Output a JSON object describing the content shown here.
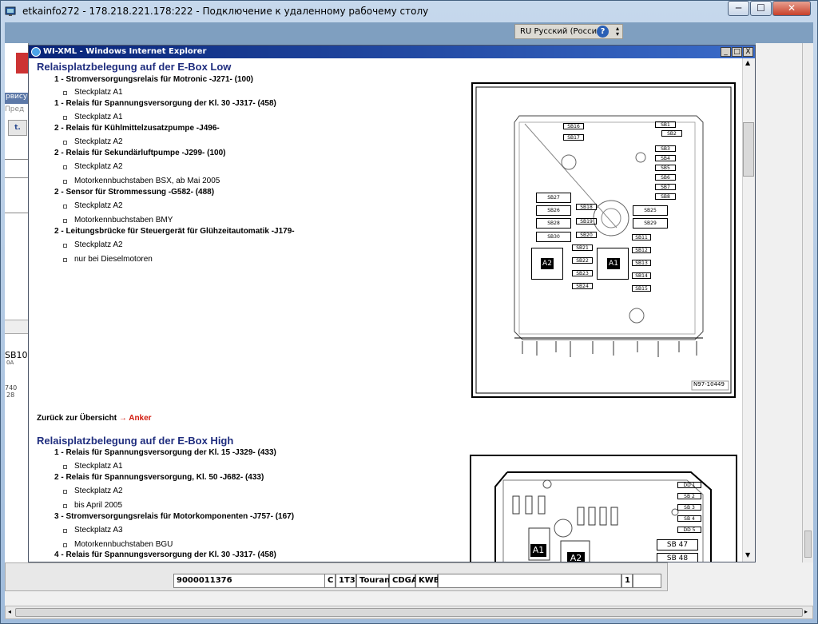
{
  "rdp": {
    "title": "etkainfo272 - 178.218.221.178:222 - Подключение к удаленному рабочему столу",
    "lang": "RU Русский (Россия)",
    "help": "?",
    "minimize": "─",
    "maximize": "☐",
    "close": "✕"
  },
  "bg": {
    "label1": "рвису",
    "label2": "Пред",
    "label3": "SB10",
    "label4": "0A",
    "label5": "740",
    "label6": "28"
  },
  "ie": {
    "title": "WI-XML - Windows Internet Explorer",
    "min": "_",
    "max": "□",
    "close": "X"
  },
  "section1": {
    "heading": "Relaisplatzbelegung auf der E-Box Low",
    "items": [
      {
        "text": "1 - Stromversorgungsrelais für Motronic -J271- (100)",
        "subs": [
          "Steckplatz A1"
        ]
      },
      {
        "text": "1 - Relais für Spannungsversorgung der Kl. 30 -J317- (458)",
        "subs": [
          "Steckplatz A1"
        ]
      },
      {
        "text": "2 - Relais für Kühlmittelzusatzpumpe -J496-",
        "subs": [
          "Steckplatz A2"
        ]
      },
      {
        "text": "2 - Relais für Sekundärluftpumpe -J299- (100)",
        "subs": [
          "Steckplatz A2",
          "Motorkennbuchstaben BSX, ab Mai 2005"
        ]
      },
      {
        "text": "2 - Sensor für Strommessung -G582- (488)",
        "subs": [
          "Steckplatz A2",
          "Motorkennbuchstaben BMY"
        ]
      },
      {
        "text": "2 - Leitungsbrücke für Steuergerät für Glühzeitautomatik -J179-",
        "subs": [
          "Steckplatz A2",
          "nur bei Dieselmotoren"
        ]
      }
    ],
    "diagram_id": "N97-10449",
    "fuses_left": [
      "SB27",
      "SB26",
      "SB28",
      "SB30"
    ],
    "fuses_top": [
      "SB16",
      "SB17"
    ],
    "fuses_right": [
      "SB1",
      "SB2",
      "SB3",
      "SB4",
      "SB5",
      "SB6",
      "SB7",
      "SB8"
    ],
    "fuses_center": [
      "SB18",
      "SB19",
      "SB20"
    ],
    "fuses_mid": [
      "SB21",
      "SB22",
      "SB23",
      "SB24"
    ],
    "fuses_rmid": [
      "SB25",
      "SB29"
    ],
    "fuses_rsmall": [
      "SB11",
      "SB12",
      "SB13",
      "SB14",
      "SB15"
    ],
    "relay_a1": "A1",
    "relay_a2": "A2"
  },
  "back": {
    "text": "Zurück zur Übersicht ",
    "link": "→ Anker"
  },
  "section2": {
    "heading": "Relaisplatzbelegung auf der E-Box High",
    "items": [
      {
        "text": "1 - Relais für Spannungsversorgung der Kl. 15 -J329- (433)",
        "subs": [
          "Steckplatz A1"
        ]
      },
      {
        "text": "2 - Relais für Spannungsversorgung, Kl. 50 -J682- (433)",
        "subs": [
          "Steckplatz A2",
          "bis April 2005"
        ]
      },
      {
        "text": "3 - Stromversorgungsrelais für Motorkomponenten -J757- (167)",
        "subs": [
          "Steckplatz A3",
          "Motorkennbuchstaben BGU"
        ]
      },
      {
        "text": "4 - Relais für Spannungsversorgung der Kl. 30 -J317- (458)",
        "subs": []
      }
    ],
    "fuses": [
      "DD 1",
      "SB 2",
      "SB 3",
      "SB 4",
      "DD 5"
    ],
    "sb47": "SB 47",
    "sb48": "SB 48",
    "relay_a1": "A1",
    "relay_a2": "A2"
  },
  "status": {
    "c1": "9000011376",
    "c2": "C",
    "c3": "1T3",
    "c4": "Touran",
    "c5": "CDGA",
    "c6": "KWB",
    "c7": "1"
  }
}
